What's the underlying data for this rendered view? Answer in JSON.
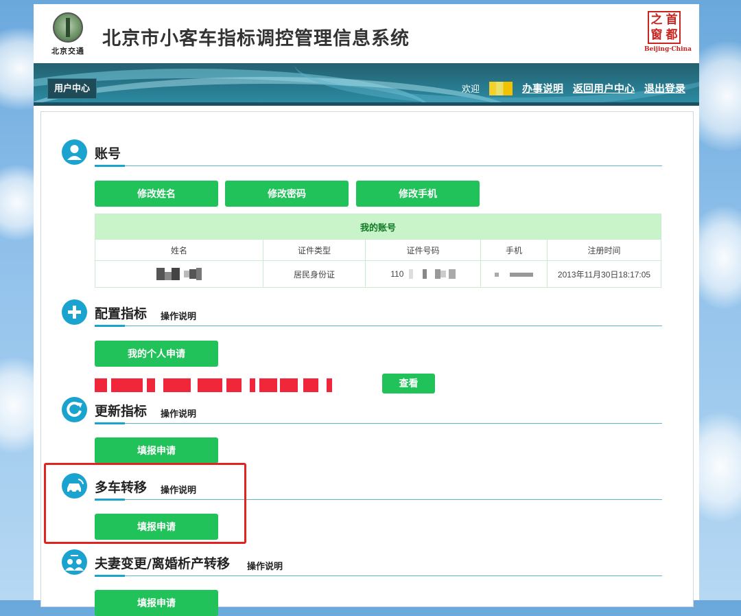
{
  "header": {
    "logo_left_text": "北京交通",
    "title": "北京市小客车指标调控管理信息系统",
    "logo_right_chars": [
      "之",
      "首",
      "窗",
      "都"
    ],
    "logo_right_caption": "Beijing·China"
  },
  "nav": {
    "user_center_tab": "用户中心",
    "welcome": "欢迎",
    "links": [
      "办事说明",
      "返回用户中心",
      "退出登录"
    ]
  },
  "account": {
    "title": "账号",
    "buttons": [
      "修改姓名",
      "修改密码",
      "修改手机"
    ],
    "table_caption": "我的账号",
    "columns": [
      "姓名",
      "证件类型",
      "证件号码",
      "手机",
      "注册时间"
    ],
    "row": {
      "id_type": "居民身份证",
      "id_prefix": "110",
      "register_time": "2013年11月30日18:17:05"
    }
  },
  "config": {
    "title": "配置指标",
    "help": "操作说明",
    "apply_button": "我的个人申请",
    "view_button": "查看"
  },
  "renew": {
    "title": "更新指标",
    "help": "操作说明",
    "button": "填报申请"
  },
  "multi_car": {
    "title": "多车转移",
    "help": "操作说明",
    "button": "填报申请"
  },
  "spouse": {
    "title": "夫妻变更/离婚析产转移",
    "help": "操作说明",
    "button": "填报申请"
  },
  "colors": {
    "accent_green": "#22c25a",
    "section_blue": "#1ba3cf",
    "highlight_red": "#e0231f"
  }
}
